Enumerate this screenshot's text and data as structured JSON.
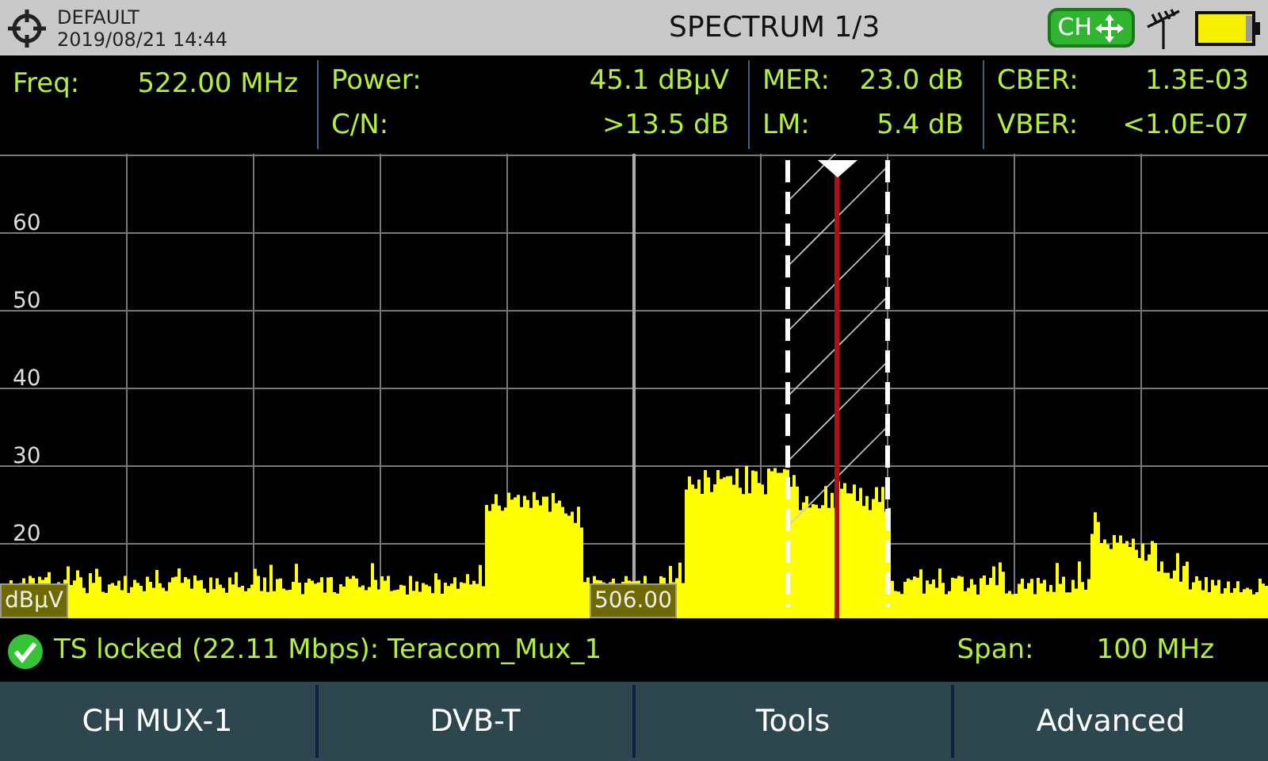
{
  "header": {
    "preset": "DEFAULT",
    "datetime": "2019/08/21 14:44",
    "title": "SPECTRUM 1/3",
    "badge": "CH"
  },
  "measurements": [
    {
      "items": [
        {
          "label": "Freq:",
          "value": "522.00 MHz"
        }
      ]
    },
    {
      "items": [
        {
          "label": "Power:",
          "value": "45.1 dBµV"
        },
        {
          "label": "C/N:",
          "value": ">13.5 dB"
        }
      ]
    },
    {
      "items": [
        {
          "label": "MER:",
          "value": "23.0 dB"
        },
        {
          "label": "LM:",
          "value": "5.4 dB"
        }
      ]
    },
    {
      "items": [
        {
          "label": "CBER:",
          "value": "1.3E-03"
        },
        {
          "label": "VBER:",
          "value": "<1.0E-07"
        }
      ]
    }
  ],
  "spectrum": {
    "y_labels": [
      "60",
      "50",
      "40",
      "30",
      "20"
    ],
    "unit": "dBµV",
    "marker_reading": "506.00"
  },
  "status": {
    "locked": true,
    "text": "TS locked (22.11 Mbps): Teracom_Mux_1",
    "span_label": "Span:",
    "span_value": "100 MHz"
  },
  "softkeys": [
    "CH MUX-1",
    "DVB-T",
    "Tools",
    "Advanced"
  ]
}
